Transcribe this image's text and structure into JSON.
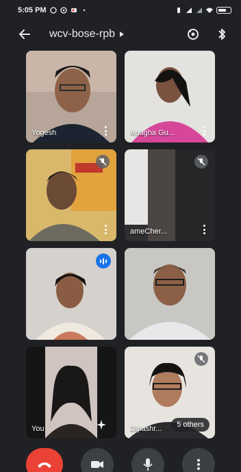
{
  "status": {
    "time": "5:05 PM"
  },
  "header": {
    "title": "wcv-bose-rpb"
  },
  "participants": [
    {
      "name": "Yogesh",
      "mic_off": false,
      "speaking": false
    },
    {
      "name": "Anagha Gu...",
      "mic_off": false,
      "speaking": false
    },
    {
      "name": "",
      "mic_off": true,
      "speaking": false
    },
    {
      "name": "ameCher...",
      "mic_off": true,
      "speaking": false
    },
    {
      "name": "",
      "mic_off": false,
      "speaking": true
    },
    {
      "name": "",
      "mic_off": false,
      "speaking": false
    },
    {
      "name": "You",
      "mic_off": false,
      "speaking": false
    },
    {
      "name": "Dipashr...",
      "mic_off": true,
      "speaking": false
    }
  ],
  "others_label": "5 others",
  "colors": {
    "background": "#202124",
    "accent": "#1a73e8",
    "end_call": "#ea4335"
  },
  "icons": [
    "back-arrow-icon",
    "switch-camera-icon",
    "bluetooth-icon",
    "mic-off-icon",
    "more-vert-icon",
    "end-call-icon",
    "camera-icon",
    "mic-icon"
  ]
}
